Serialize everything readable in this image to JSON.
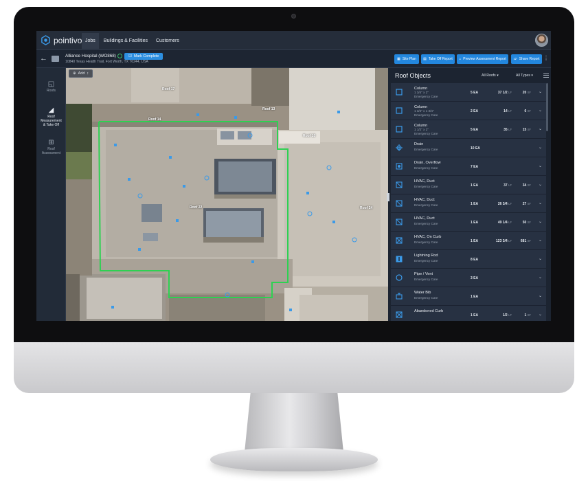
{
  "app": {
    "logo_text": "pointivo",
    "nav": [
      "Jobs",
      "Buildings & Facilities",
      "Customers"
    ]
  },
  "job": {
    "name": "Alliance Hospital (WO868)",
    "address": "10840 Texas Health Trail, Fort Worth, TX 76244, USA",
    "mark_complete": "Mark Complete"
  },
  "toolbar": {
    "site_plan": "Site Plan",
    "take_off_report": "Take Off Report",
    "preview_report": "Preview Assessment Report",
    "share_report": "Share Report"
  },
  "tools": {
    "roofs": "Roofs",
    "measure_l1": "Roof",
    "measure_l2": "Measurement",
    "measure_l3": "& Take Off",
    "assess_l1": "Roof",
    "assess_l2": "Assessment"
  },
  "map": {
    "add_label": "Add",
    "labels": [
      "Roof 17",
      "Roof 13",
      "Roof 14",
      "Roof 10",
      "Roof 22",
      "Roof 24"
    ]
  },
  "panel": {
    "title": "Roof Objects",
    "filter_roofs": "All Roofs",
    "filter_types": "All Types"
  },
  "rows": [
    {
      "icon": "square-icon",
      "name": "Column",
      "sub1": "1 3/4\" x 2\"",
      "sub2": "Emergency Care",
      "ea": "5 EA",
      "lf_n": "37 1/2",
      "lf_u": "LF",
      "sf_n": "20",
      "sf_u": "SF"
    },
    {
      "icon": "square-icon",
      "name": "Column",
      "sub1": "1 3/4\" x 1 3/4\"",
      "sub2": "Emergency Care",
      "ea": "2 EA",
      "lf_n": "14",
      "lf_u": "LF",
      "sf_n": "6",
      "sf_u": "SF"
    },
    {
      "icon": "square-icon",
      "name": "Column",
      "sub1": "1 1/2\" x 2\"",
      "sub2": "Emergency Care",
      "ea": "5 EA",
      "lf_n": "35",
      "lf_u": "LF",
      "sf_n": "15",
      "sf_u": "SF"
    },
    {
      "icon": "drain-icon",
      "name": "Drain",
      "sub1": "Emergency Care",
      "sub2": "",
      "ea": "10 EA",
      "lf_n": "",
      "lf_u": "",
      "sf_n": "",
      "sf_u": ""
    },
    {
      "icon": "overflow-drain-icon",
      "name": "Drain, Overflow",
      "sub1": "Emergency Care",
      "sub2": "",
      "ea": "7 EA",
      "lf_n": "",
      "lf_u": "",
      "sf_n": "",
      "sf_u": ""
    },
    {
      "icon": "duct-icon",
      "name": "HVAC, Duct",
      "sub1": "Emergency Care",
      "sub2": "",
      "ea": "1 EA",
      "lf_n": "37",
      "lf_u": "LF",
      "sf_n": "34",
      "sf_u": "SF"
    },
    {
      "icon": "duct-icon",
      "name": "HVAC, Duct",
      "sub1": "Emergency Care",
      "sub2": "",
      "ea": "1 EA",
      "lf_n": "26 3/4",
      "lf_u": "LF",
      "sf_n": "27",
      "sf_u": "SF"
    },
    {
      "icon": "duct-icon",
      "name": "HVAC, Duct",
      "sub1": "Emergency Care",
      "sub2": "",
      "ea": "1 EA",
      "lf_n": "49 1/4",
      "lf_u": "LF",
      "sf_n": "50",
      "sf_u": "SF"
    },
    {
      "icon": "curb-icon",
      "name": "HVAC, On Curb",
      "sub1": "Emergency Care",
      "sub2": "",
      "ea": "1 EA",
      "lf_n": "123 3/4",
      "lf_u": "LF",
      "sf_n": "681",
      "sf_u": "SF"
    },
    {
      "icon": "lightning-rod-icon",
      "name": "Lightning Rod",
      "sub1": "Emergency Care",
      "sub2": "",
      "ea": "8 EA",
      "lf_n": "",
      "lf_u": "",
      "sf_n": "",
      "sf_u": ""
    },
    {
      "icon": "circle-icon",
      "name": "Pipe / Vent",
      "sub1": "Emergency Care",
      "sub2": "",
      "ea": "3 EA",
      "lf_n": "",
      "lf_u": "",
      "sf_n": "",
      "sf_u": ""
    },
    {
      "icon": "water-bib-icon",
      "name": "Water Bib",
      "sub1": "Emergency Care",
      "sub2": "",
      "ea": "1 EA",
      "lf_n": "",
      "lf_u": "",
      "sf_n": "",
      "sf_u": ""
    },
    {
      "icon": "curb-icon",
      "name": "Abandoned Curb",
      "sub1": "",
      "sub2": "",
      "ea": "1 EA",
      "lf_n": "1/2",
      "lf_u": "LF",
      "sf_n": "1",
      "sf_u": "SF"
    }
  ]
}
